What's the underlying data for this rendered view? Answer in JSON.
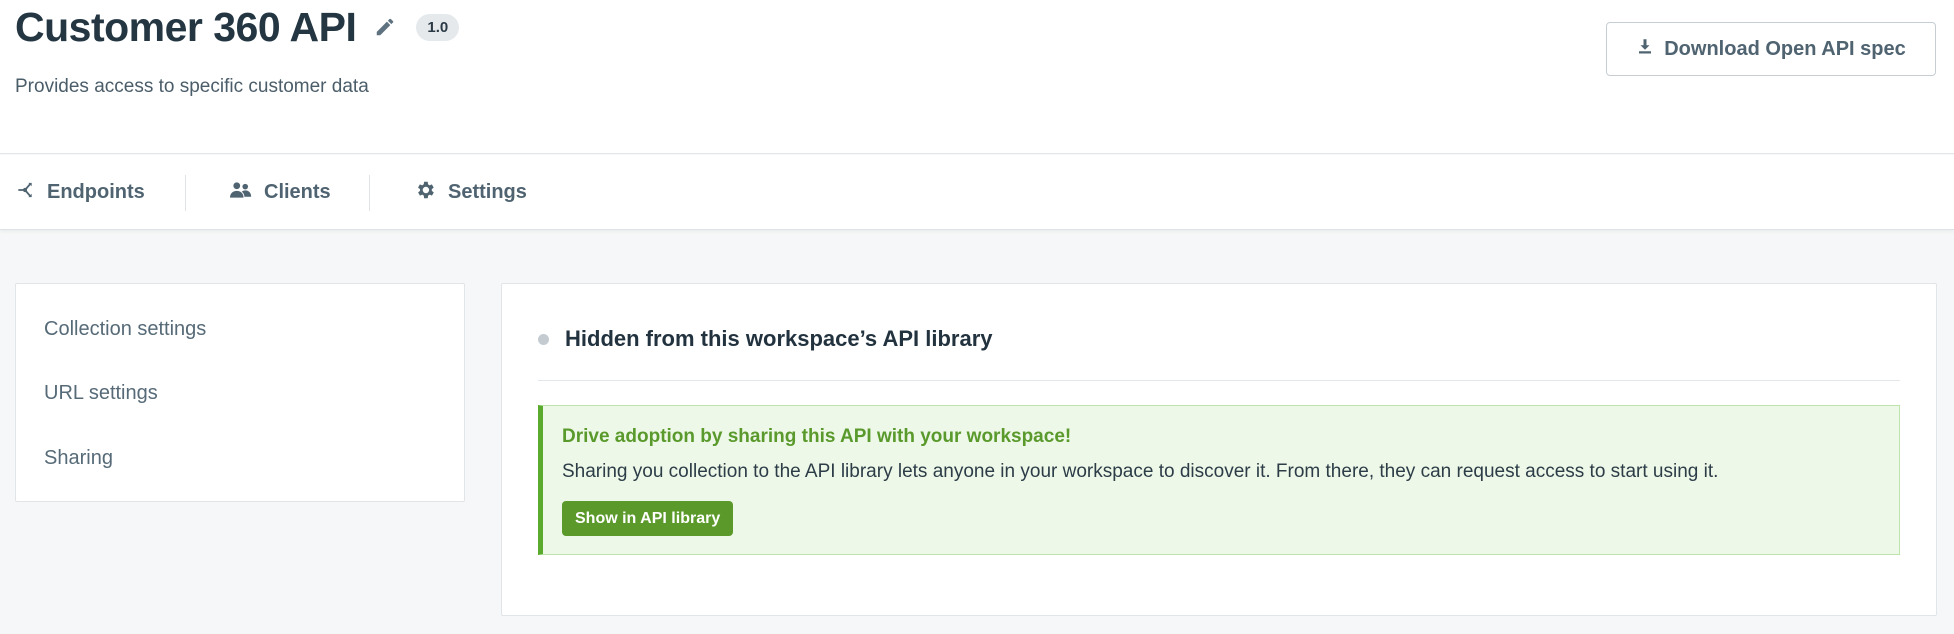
{
  "header": {
    "title": "Customer 360 API",
    "version": "1.0",
    "subtitle": "Provides access to specific customer data",
    "download_label": "Download Open API spec"
  },
  "tabs": [
    {
      "label": "Endpoints",
      "icon": "endpoints-icon"
    },
    {
      "label": "Clients",
      "icon": "users-icon"
    },
    {
      "label": "Settings",
      "icon": "gear-icon"
    }
  ],
  "sidebar": {
    "items": [
      {
        "label": "Collection settings"
      },
      {
        "label": "URL settings"
      },
      {
        "label": "Sharing"
      }
    ]
  },
  "sharing": {
    "status": "Hidden from this workspace’s API library",
    "promo_title": "Drive adoption by sharing this API with your workspace!",
    "promo_text": "Sharing you collection to the API library lets anyone in your workspace to discover it. From there, they can request access to start using it.",
    "promo_button": "Show in API library"
  },
  "colors": {
    "accent_green": "#5b9a2a",
    "promo_bg": "#eef8e8",
    "text_dark": "#233642"
  }
}
